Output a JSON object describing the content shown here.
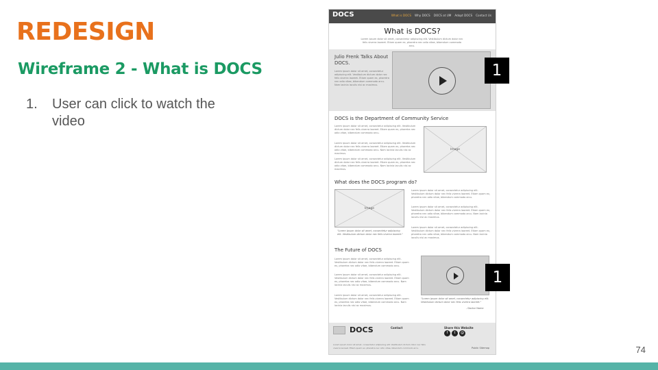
{
  "slide": {
    "title": "REDESIGN",
    "subtitle": "Wireframe 2 - What is DOCS",
    "bullets": [
      {
        "num": "1.",
        "text": "User can click to watch the video"
      }
    ],
    "page_number": "74",
    "colors": {
      "title": "#e8711c",
      "subtitle": "#1b9a63",
      "bottom_bar": "#55b3a7"
    }
  },
  "wireframe": {
    "logo": "DOCS",
    "nav": [
      "What is DOCS",
      "Why DOCS",
      "DOCS at UM",
      "Adopt DOCS",
      "Contact Us"
    ],
    "page_title": "What is DOCS?",
    "intro_lorem": "Lorem ipsum dolor sit amet, consectetur adipiscing elit. Vestibulum dictum dolor nec felis viverra laoreet. Etiam quam ex, pharetra nec odio vitae, bibendum commodo arcu.",
    "hero": {
      "title": "Julio Frenk Talks About DOCS.",
      "lorem": "Lorem ipsum dolor sit amet, consectetur adipiscing elit. Vestibulum dictum dolor nec felis viverra laoreet. Etiam quam ex, pharetra nec odio vitae, bibendum commodo arcu. Nam lacinia iaculis nisi ac maximus."
    },
    "section1": {
      "title": "DOCS is the Department of Community Service",
      "image_label": "Image"
    },
    "section2": {
      "title": "What does the DOCS program do?",
      "image_label": "Image",
      "caption": "\"Lorem ipsum dolor sit amet, consectetur adipiscing elit. Vestibulum dictum dolor nec felis viverra laoreet.\""
    },
    "section3": {
      "title": "The Future of DOCS",
      "caption": "\"Lorem ipsum dolor sit amet, consectetur adipiscing elit. Vestibulum dictum dolor nec felis viverra laoreet.\"",
      "attribution": "- Doctor Name"
    },
    "footer": {
      "logo": "DOCS",
      "contact_label": "Contact",
      "share_label": "Share this Website",
      "right_note": "Public Sitemap"
    },
    "annotation_badges": [
      "1",
      "1"
    ]
  }
}
